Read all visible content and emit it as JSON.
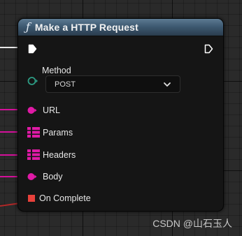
{
  "node": {
    "title": "Make a HTTP Request",
    "function_icon": "function-icon"
  },
  "method": {
    "label": "Method",
    "selected": "POST"
  },
  "pins": {
    "url": "URL",
    "params": "Params",
    "headers": "Headers",
    "body": "Body",
    "on_complete": "On Complete"
  },
  "watermark": "CSDN @山石玉人",
  "colors": {
    "header": "#4a6780",
    "string_pin": "#e01aa6",
    "exec_pin": "#ffffff",
    "event_pin": "#e8413b",
    "method_pin": "#2d9c84",
    "node_body": "#151515"
  }
}
